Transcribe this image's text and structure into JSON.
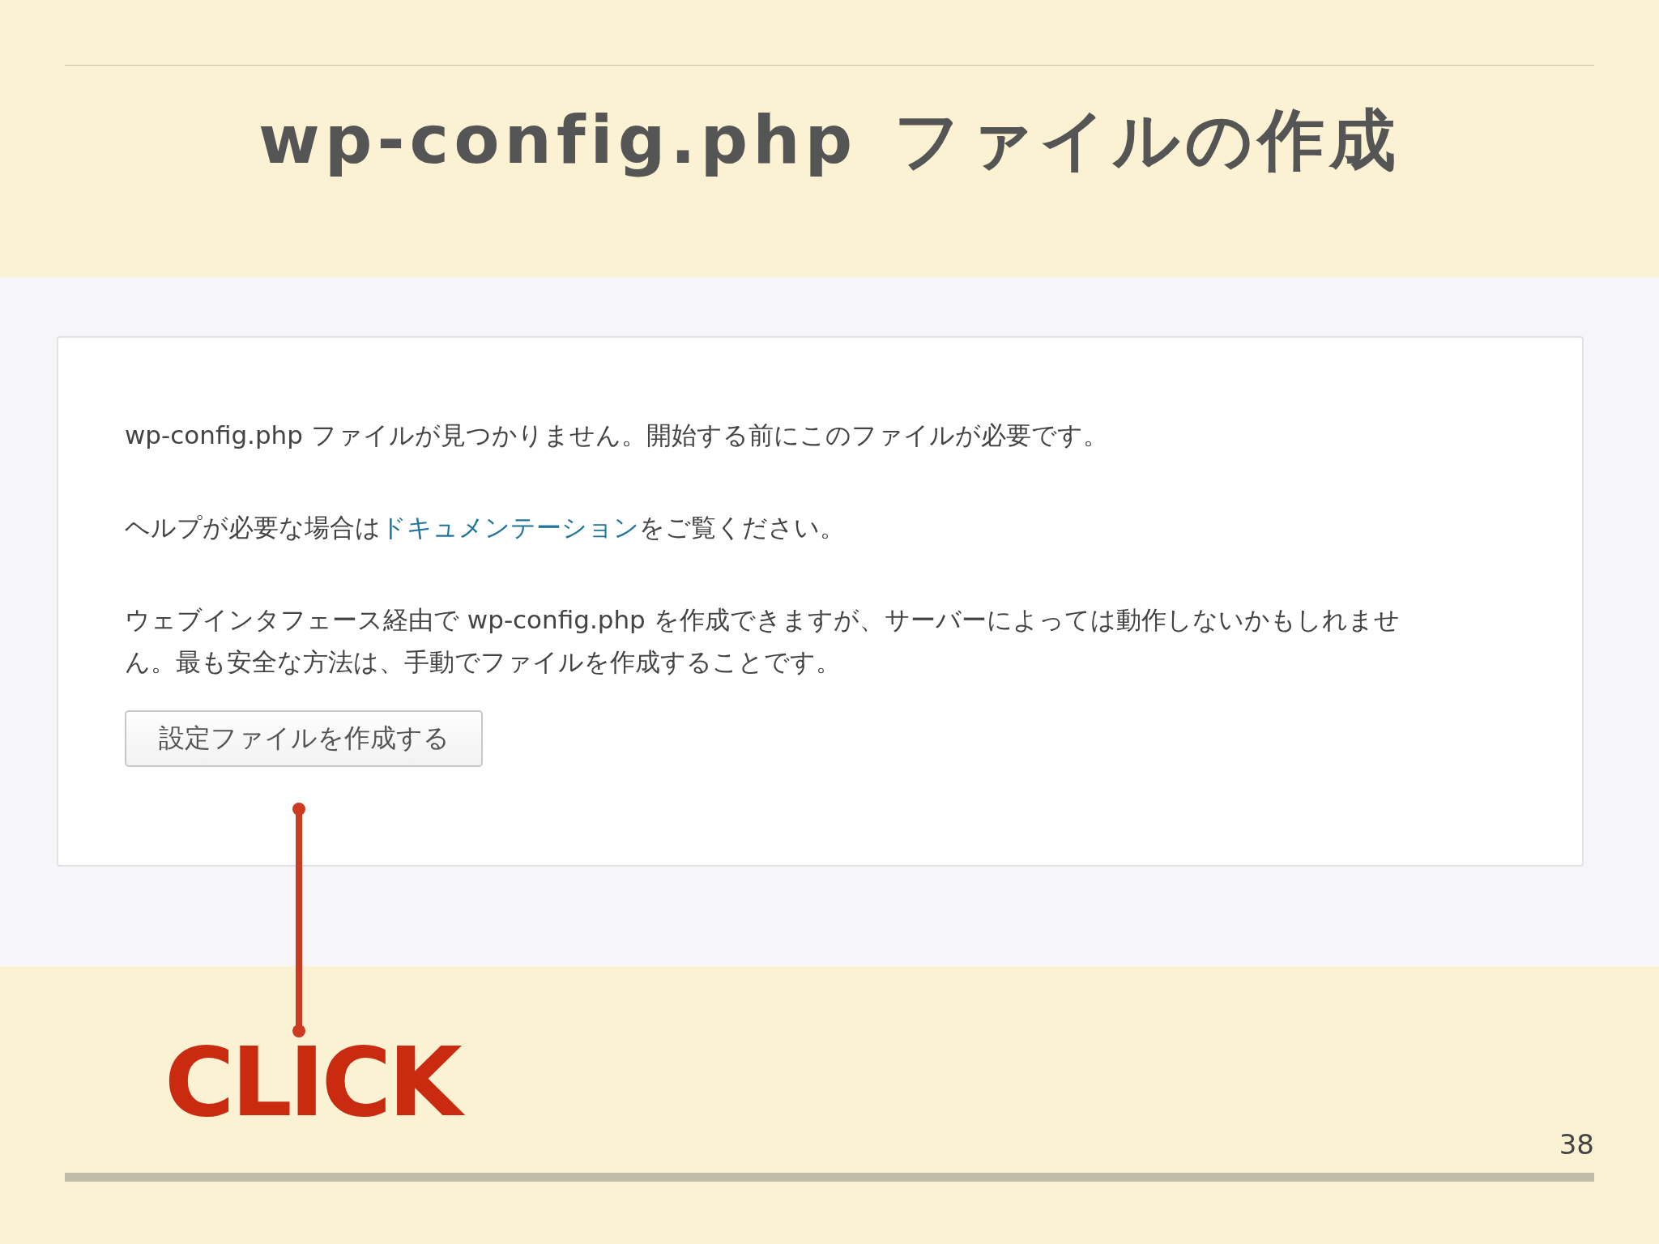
{
  "slide": {
    "title": "wp-config.php ファイルの作成",
    "page_number": "38",
    "annotation": "CLICK"
  },
  "setup_card": {
    "paragraphs": [
      {
        "text": "wp-config.php ファイルが見つかりません。開始する前にこのファイルが必要です。"
      },
      {
        "before": "ヘルプが必要な場合は",
        "link": "ドキュメンテーション",
        "after": "をご覧ください。"
      },
      {
        "text": "ウェブインタフェース経由で wp-config.php を作成できますが、サーバーによっては動作しないかもしれません。最も安全な方法は、手動でファイルを作成することです。"
      }
    ],
    "button": "設定ファイルを作成する"
  }
}
